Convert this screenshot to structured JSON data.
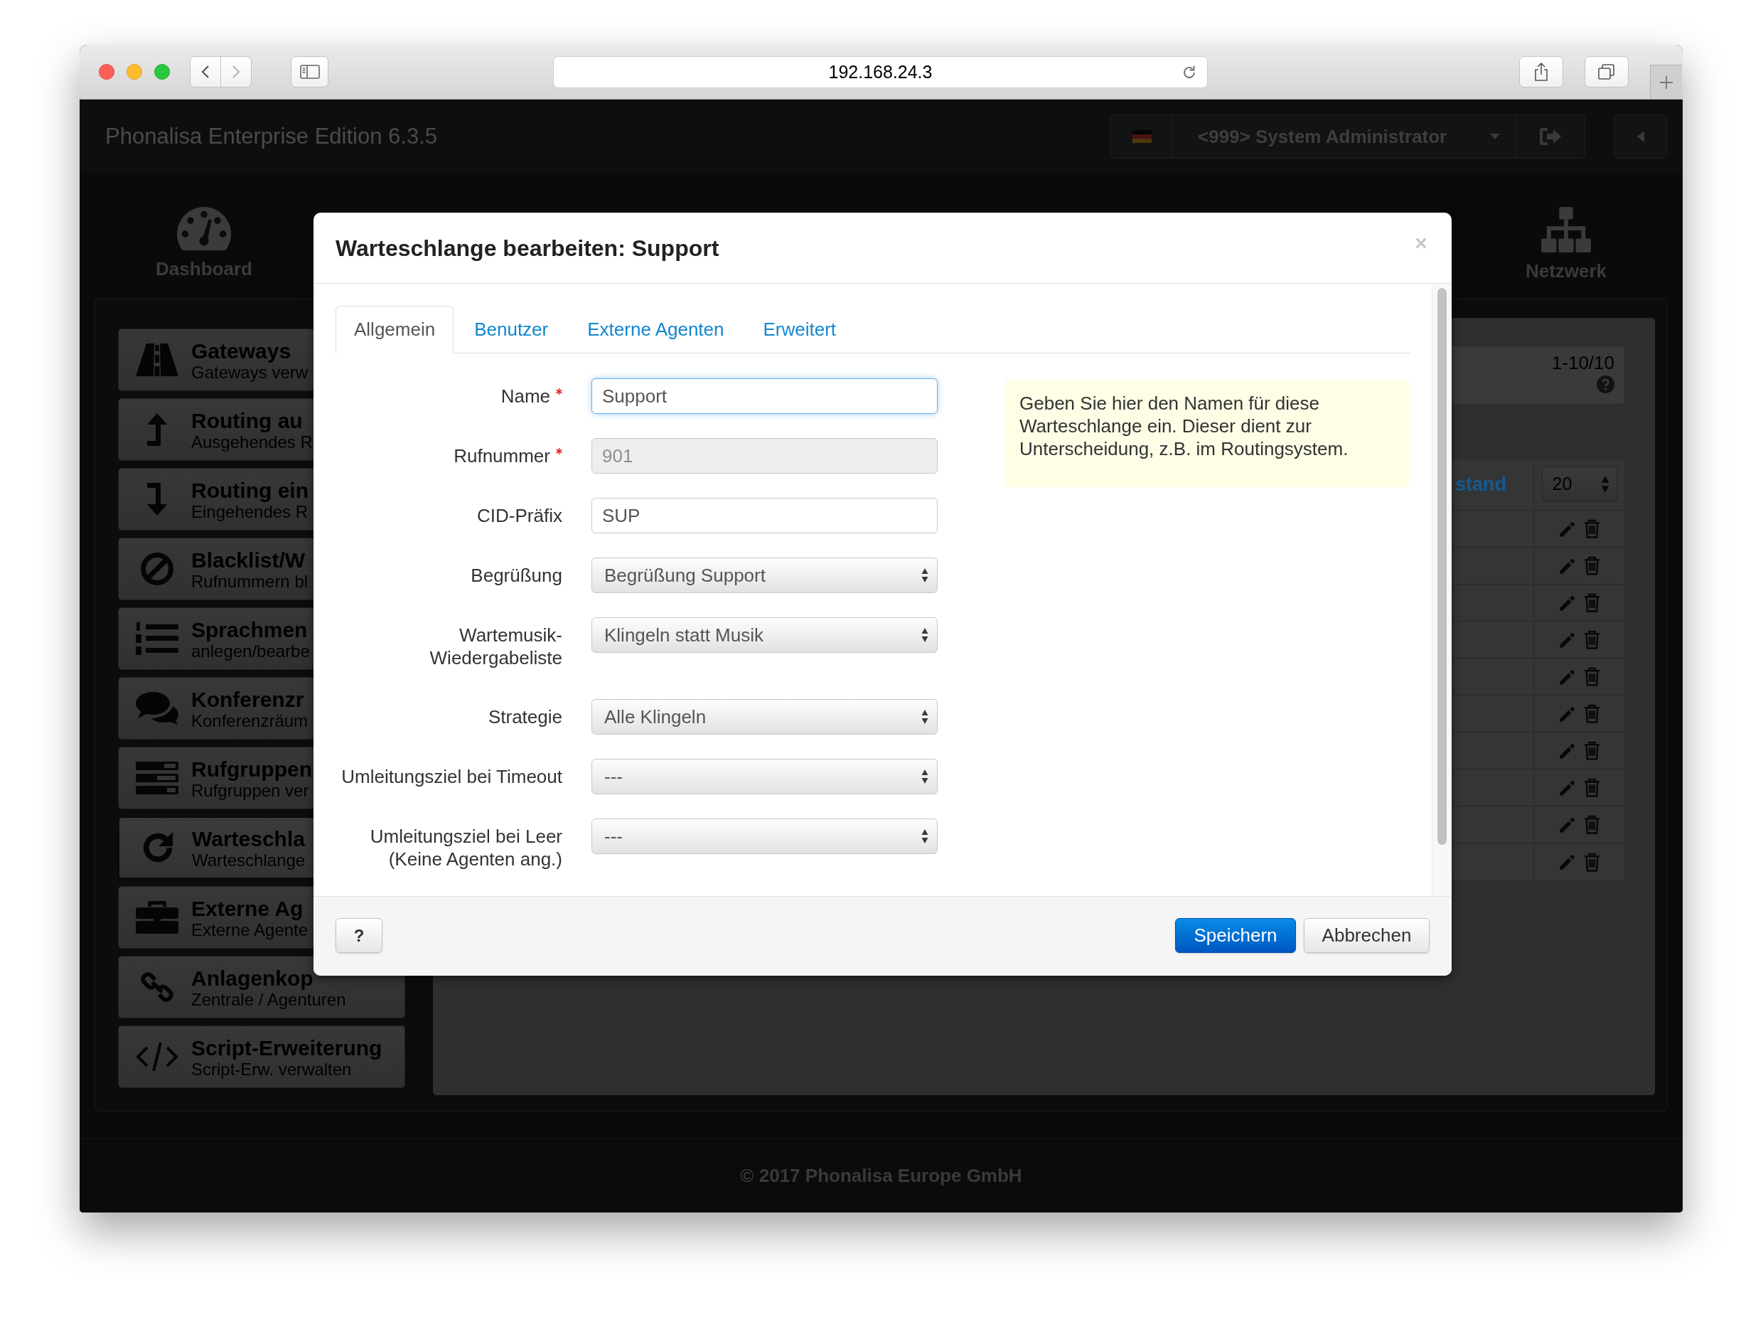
{
  "browser": {
    "url": "192.168.24.3"
  },
  "header": {
    "title": "Phonalisa Enterprise Edition 6.3.5",
    "user_menu": "<999> System Administrator"
  },
  "nav": [
    {
      "label": "Dashboard"
    },
    {
      "label": "Netzwerk"
    }
  ],
  "sidebar": {
    "items": [
      {
        "title": "Gateways",
        "subtitle": "Gateways verw",
        "selected": false
      },
      {
        "title": "Routing au",
        "subtitle": "Ausgehendes R",
        "selected": false
      },
      {
        "title": "Routing ein",
        "subtitle": "Eingehendes R",
        "selected": false
      },
      {
        "title": "Blacklist/W",
        "subtitle": "Rufnummern bl",
        "selected": false
      },
      {
        "title": "Sprachmen",
        "subtitle": "anlegen/bearbe",
        "selected": false
      },
      {
        "title": "Konferenzr",
        "subtitle": "Konferenzräum",
        "selected": false
      },
      {
        "title": "Rufgruppen",
        "subtitle": "Rufgruppen ver",
        "selected": false
      },
      {
        "title": "Warteschla",
        "subtitle": "Warteschlange",
        "selected": true
      },
      {
        "title": "Externe Ag",
        "subtitle": "Externe Agente",
        "selected": false
      },
      {
        "title": "Anlagenkop",
        "subtitle": "Zentrale / Agenturen",
        "selected": false
      },
      {
        "title": "Script-Erweiterung",
        "subtitle": "Script-Erw. verwalten",
        "selected": false
      }
    ]
  },
  "list_panel": {
    "pagination": "1-10/10",
    "table": {
      "columns": [
        {
          "label": "stand"
        }
      ],
      "page_size": "20"
    }
  },
  "dialog": {
    "title": "Warteschlange bearbeiten: Support",
    "tabs": [
      {
        "label": "Allgemein",
        "selected": true
      },
      {
        "label": "Benutzer",
        "selected": false
      },
      {
        "label": "Externe Agenten",
        "selected": false
      },
      {
        "label": "Erweitert",
        "selected": false
      }
    ],
    "fields": [
      {
        "label": "Name",
        "kind": "text",
        "value": "Support",
        "required": true,
        "disabled": false,
        "focused": true
      },
      {
        "label": "Rufnummer",
        "kind": "text",
        "value": "901",
        "required": true,
        "disabled": true,
        "focused": false
      },
      {
        "label": "CID-Präfix",
        "kind": "text",
        "value": "SUP",
        "required": false,
        "disabled": false,
        "focused": false
      },
      {
        "label": "Begrüßung",
        "kind": "select",
        "value": "Begrüßung Support",
        "required": false,
        "disabled": false,
        "focused": false
      },
      {
        "label": "Wartemusik-Wiedergabeliste",
        "kind": "select",
        "value": "Klingeln statt Musik",
        "required": false,
        "disabled": false,
        "focused": false
      },
      {
        "label": "Strategie",
        "kind": "select",
        "value": "Alle Klingeln",
        "required": false,
        "disabled": false,
        "focused": false
      },
      {
        "label": "Umleitungsziel bei Timeout",
        "kind": "select",
        "value": "---",
        "required": false,
        "disabled": false,
        "focused": false
      },
      {
        "label": "Umleitungsziel bei Leer (Keine Agenten ang.)",
        "kind": "select",
        "value": "---",
        "required": false,
        "disabled": false,
        "focused": false
      }
    ],
    "help_text": "Geben Sie hier den Namen für diese Warteschlange ein. Dieser dient zur Unterscheidung, z.B. im Routingsystem.",
    "buttons": [
      {
        "label": "?",
        "kind": "help"
      },
      {
        "label": "Speichern",
        "kind": "primary"
      },
      {
        "label": "Abbrechen",
        "kind": "default"
      }
    ]
  },
  "footer": {
    "copyright": "© 2017 Phonalisa Europe GmbH"
  }
}
